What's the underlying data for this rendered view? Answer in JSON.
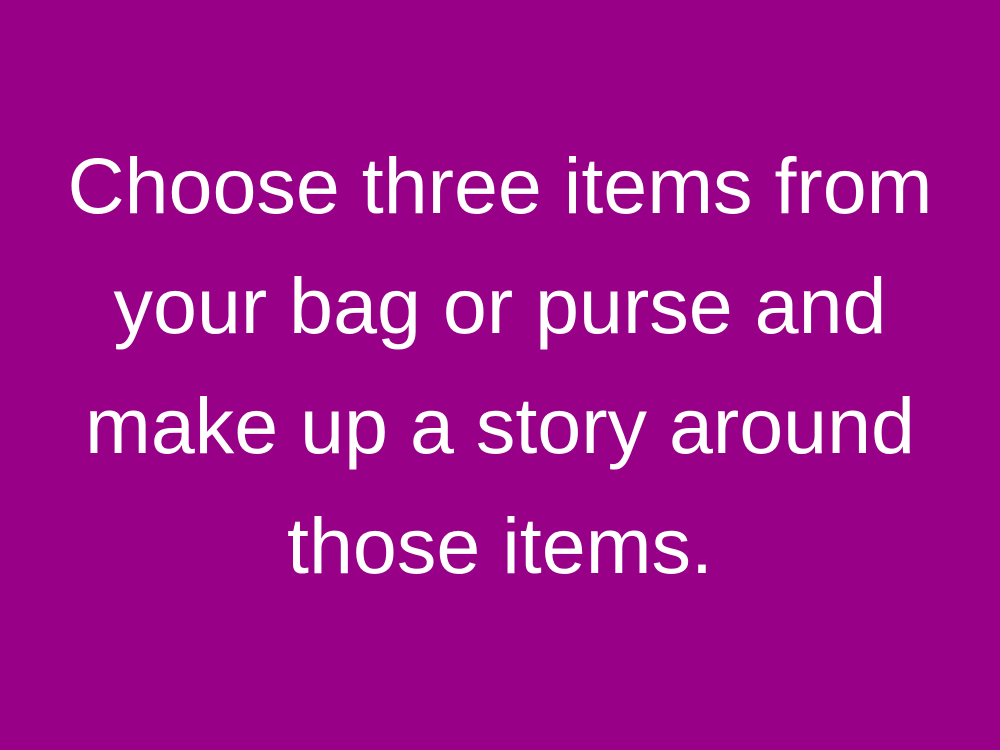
{
  "slide": {
    "background_color": "#990088",
    "text_color": "#ffffff",
    "lines": [
      "Choose three items from",
      "your bag or purse and",
      "make up a story around",
      "those items."
    ]
  }
}
